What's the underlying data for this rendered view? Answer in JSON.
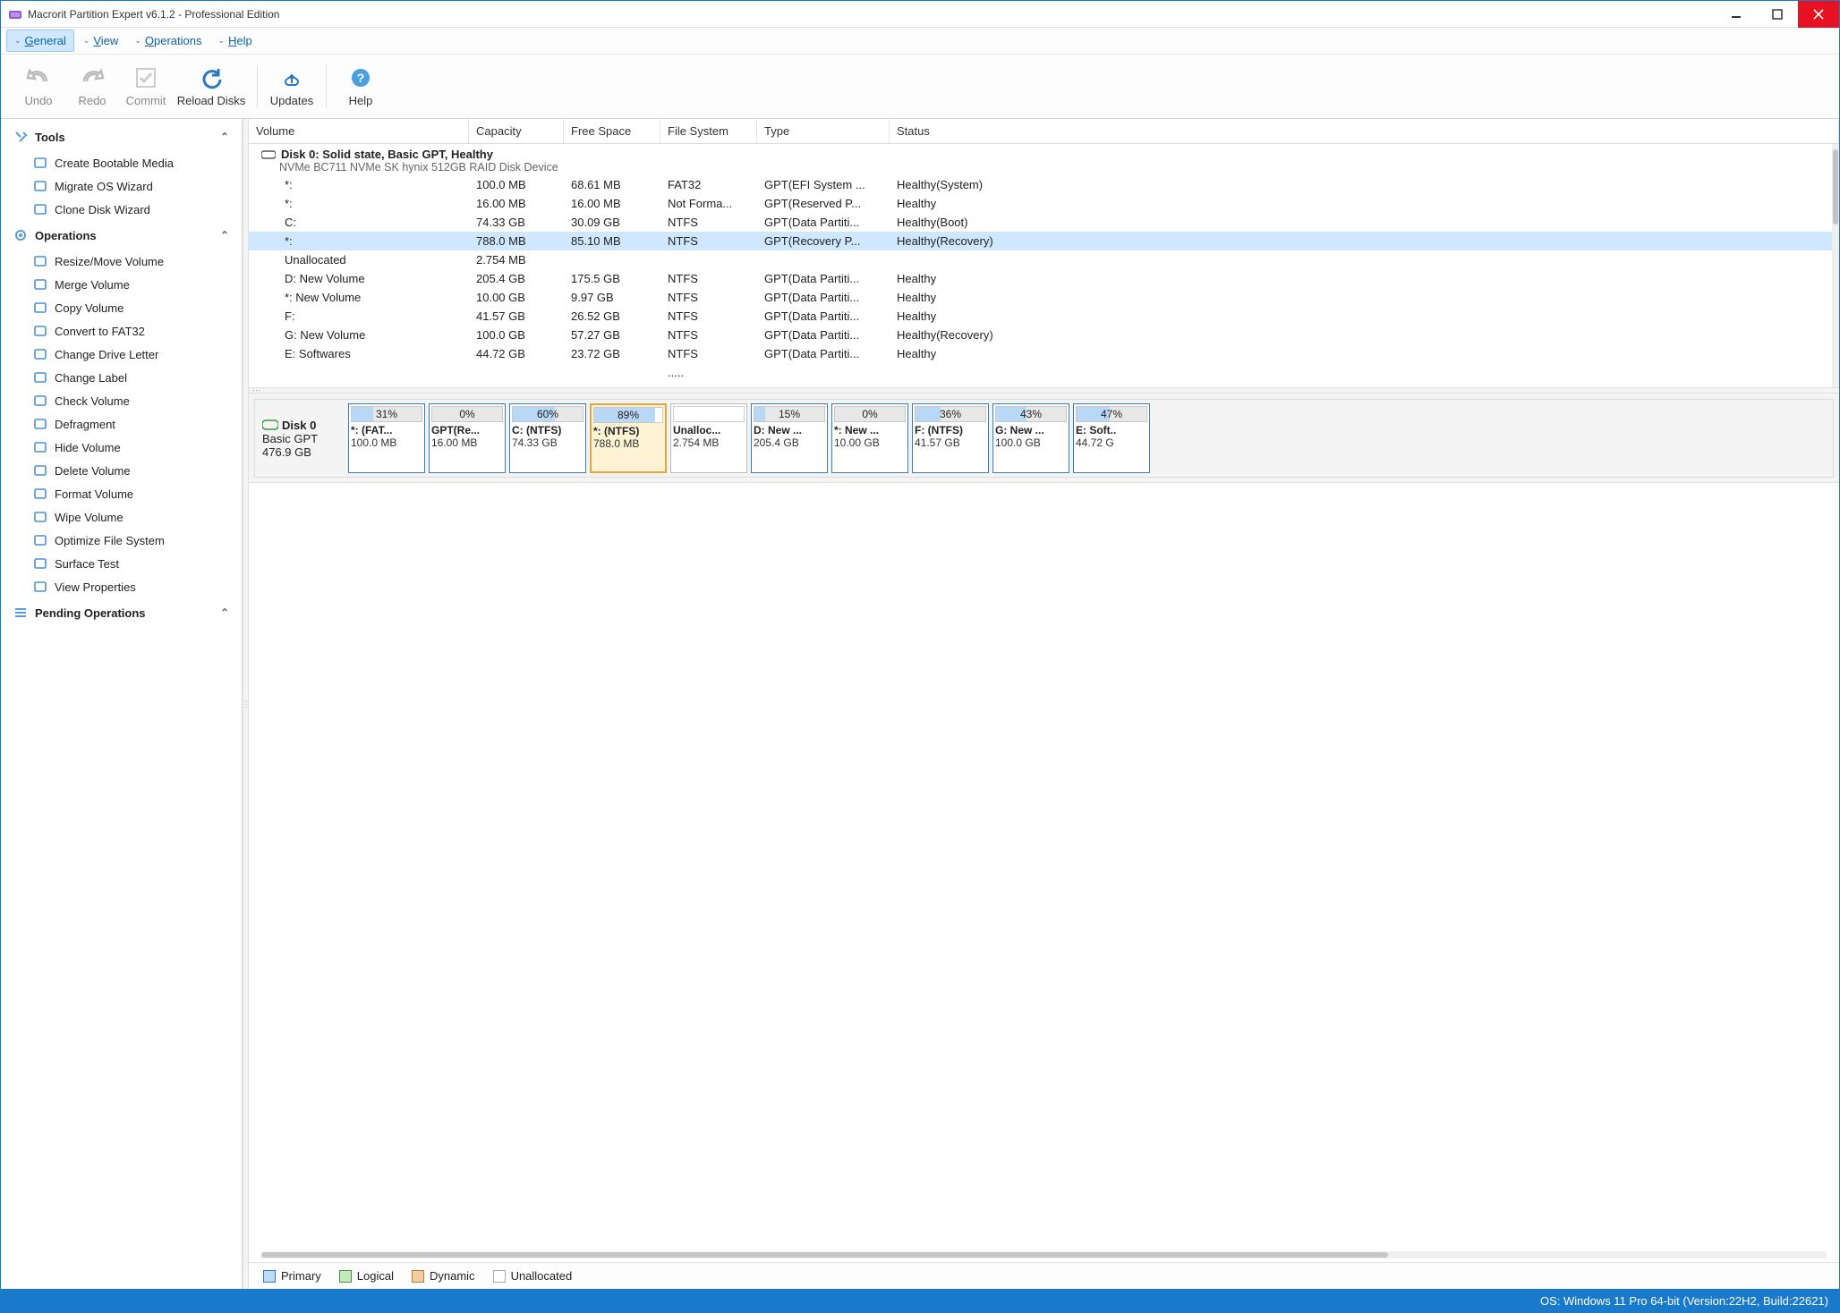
{
  "titlebar": {
    "title": "Macrorit Partition Expert v6.1.2 - Professional Edition"
  },
  "menubar": {
    "items": [
      {
        "label": "General",
        "underline": "G",
        "rest": "eneral",
        "active": true
      },
      {
        "label": "View",
        "underline": "V",
        "rest": "iew"
      },
      {
        "label": "Operations",
        "underline": "O",
        "rest": "perations"
      },
      {
        "label": "Help",
        "underline": "H",
        "rest": "elp"
      }
    ]
  },
  "toolbar": {
    "undo": "Undo",
    "redo": "Redo",
    "commit": "Commit",
    "reload": "Reload Disks",
    "updates": "Updates",
    "help": "Help"
  },
  "sidebar": {
    "tools_head": "Tools",
    "tools": [
      {
        "label": "Create Bootable Media"
      },
      {
        "label": "Migrate OS Wizard"
      },
      {
        "label": "Clone Disk Wizard"
      }
    ],
    "ops_head": "Operations",
    "ops": [
      {
        "label": "Resize/Move Volume"
      },
      {
        "label": "Merge Volume"
      },
      {
        "label": "Copy Volume"
      },
      {
        "label": "Convert to FAT32"
      },
      {
        "label": "Change Drive Letter"
      },
      {
        "label": "Change Label"
      },
      {
        "label": "Check Volume"
      },
      {
        "label": "Defragment"
      },
      {
        "label": "Hide Volume"
      },
      {
        "label": "Delete Volume"
      },
      {
        "label": "Format Volume"
      },
      {
        "label": "Wipe Volume"
      },
      {
        "label": "Optimize File System"
      },
      {
        "label": "Surface Test"
      },
      {
        "label": "View Properties"
      }
    ],
    "pending_head": "Pending Operations"
  },
  "grid": {
    "headers": {
      "volume": "Volume",
      "capacity": "Capacity",
      "free": "Free Space",
      "fs": "File System",
      "type": "Type",
      "status": "Status"
    },
    "disk_title": "Disk 0: Solid state, Basic GPT, Healthy",
    "disk_sub": "NVMe BC711 NVMe SK hynix 512GB RAID Disk Device",
    "rows": [
      {
        "vol": "*:",
        "cap": "100.0 MB",
        "free": "68.61 MB",
        "fs": "FAT32",
        "type": "GPT(EFI System ...",
        "status": "Healthy(System)"
      },
      {
        "vol": "*:",
        "cap": "16.00 MB",
        "free": "16.00 MB",
        "fs": "Not Forma...",
        "type": "GPT(Reserved P...",
        "status": "Healthy"
      },
      {
        "vol": "C:",
        "cap": "74.33 GB",
        "free": "30.09 GB",
        "fs": "NTFS",
        "type": "GPT(Data Partiti...",
        "status": "Healthy(Boot)"
      },
      {
        "vol": "*:",
        "cap": "788.0 MB",
        "free": "85.10 MB",
        "fs": "NTFS",
        "type": "GPT(Recovery P...",
        "status": "Healthy(Recovery)",
        "selected": true
      },
      {
        "vol": "Unallocated",
        "cap": "2.754 MB",
        "free": "",
        "fs": "",
        "type": "",
        "status": ""
      },
      {
        "vol": "D: New Volume",
        "cap": "205.4 GB",
        "free": "175.5 GB",
        "fs": "NTFS",
        "type": "GPT(Data Partiti...",
        "status": "Healthy"
      },
      {
        "vol": "*: New Volume",
        "cap": "10.00 GB",
        "free": "9.97 GB",
        "fs": "NTFS",
        "type": "GPT(Data Partiti...",
        "status": "Healthy"
      },
      {
        "vol": "F:",
        "cap": "41.57 GB",
        "free": "26.52 GB",
        "fs": "NTFS",
        "type": "GPT(Data Partiti...",
        "status": "Healthy"
      },
      {
        "vol": "G: New Volume",
        "cap": "100.0 GB",
        "free": "57.27 GB",
        "fs": "NTFS",
        "type": "GPT(Data Partiti...",
        "status": "Healthy(Recovery)"
      },
      {
        "vol": "E: Softwares",
        "cap": "44.72 GB",
        "free": "23.72 GB",
        "fs": "NTFS",
        "type": "GPT(Data Partiti...",
        "status": "Healthy"
      },
      {
        "vol": "",
        "cap": "",
        "free": "",
        "fs": ".....",
        "type": "",
        "status": ""
      }
    ]
  },
  "diskmap": {
    "disk_name": "Disk 0",
    "disk_type": "Basic GPT",
    "disk_size": "476.9 GB",
    "parts": [
      {
        "pct": "31%",
        "label": "*: (FAT...",
        "size": "100.0 MB",
        "fill": 31
      },
      {
        "pct": "0%",
        "label": "GPT(Re...",
        "size": "16.00 MB",
        "fill": 0
      },
      {
        "pct": "60%",
        "label": "C: (NTFS)",
        "size": "74.33 GB",
        "fill": 60
      },
      {
        "pct": "89%",
        "label": "*: (NTFS)",
        "size": "788.0 MB",
        "fill": 89,
        "selected": true
      },
      {
        "pct": "",
        "label": "Unalloc...",
        "size": "2.754 MB",
        "unalloc": true
      },
      {
        "pct": "15%",
        "label": "D: New ...",
        "size": "205.4 GB",
        "fill": 15
      },
      {
        "pct": "0%",
        "label": "*: New ...",
        "size": "10.00 GB",
        "fill": 0
      },
      {
        "pct": "36%",
        "label": "F: (NTFS)",
        "size": "41.57 GB",
        "fill": 36
      },
      {
        "pct": "43%",
        "label": "G: New ...",
        "size": "100.0 GB",
        "fill": 43
      },
      {
        "pct": "47%",
        "label": "E: Soft..",
        "size": "44.72 G",
        "fill": 47
      }
    ]
  },
  "legend": {
    "primary": "Primary",
    "logical": "Logical",
    "dynamic": "Dynamic",
    "unallocated": "Unallocated"
  },
  "statusbar": {
    "os": "OS: Windows 11 Pro 64-bit (Version:22H2, Build:22621)"
  }
}
